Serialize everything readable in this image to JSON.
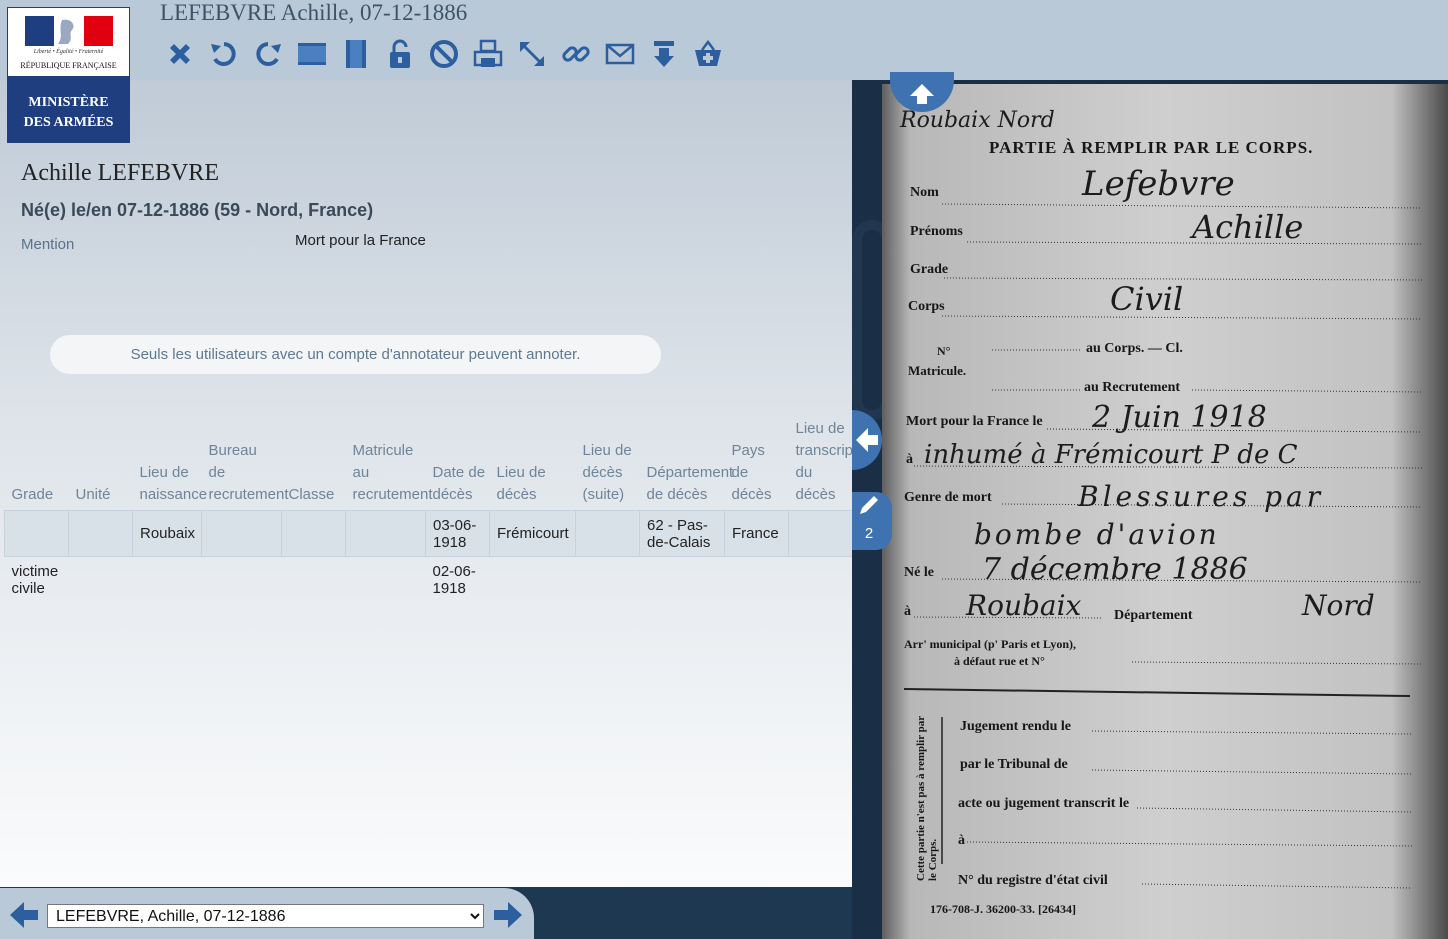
{
  "header": {
    "title": "LEFEBVRE Achille, 07-12-1886",
    "logo": {
      "motto": "Liberté • Égalité • Fraternité",
      "republic": "RÉPUBLIQUE FRANÇAISE",
      "ministry_line1": "MINISTÈRE",
      "ministry_line2": "DES ARMÉES"
    },
    "toolbar": [
      "close-icon",
      "rotate-left-icon",
      "rotate-right-icon",
      "fit-width-icon",
      "fit-height-icon",
      "unlock-icon",
      "block-icon",
      "print-icon",
      "fullscreen-icon",
      "link-icon",
      "mail-icon",
      "download-icon",
      "basket-icon"
    ],
    "accent": "#2d5f9e"
  },
  "record": {
    "name": "Achille LEFEBVRE",
    "birth": "Né(e) le/en 07-12-1886 (59 - Nord, France)",
    "mention_label": "Mention",
    "mention_value": "Mort pour la France",
    "annotation_notice": "Seuls les utilisateurs avec un compte d'annotateur peuvent annoter."
  },
  "table": {
    "headers": [
      "Grade",
      "Unité",
      "Lieu de naissance",
      "Bureau de recrutement",
      "Classe",
      "Matricule au recrutement",
      "Date de décès",
      "Lieu de décès",
      "Lieu de décès (suite)",
      "Département de décès",
      "Pays de décès",
      "Lieu de transcription du décès"
    ],
    "rows": [
      [
        "",
        "",
        "Roubaix",
        "",
        "",
        "",
        "03-06-1918",
        "Frémicourt",
        "",
        "62 - Pas-de-Calais",
        "France",
        ""
      ],
      [
        "victime civile",
        "",
        "",
        "",
        "",
        "",
        "02-06-1918",
        "",
        "",
        "",
        "",
        ""
      ]
    ]
  },
  "nav": {
    "selected_record": "LEFEBVRE, Achille, 07-12-1886"
  },
  "viewer": {
    "annotation_count": "2",
    "document": {
      "heading": "PARTIE À REMPLIR PAR LE CORPS.",
      "corner_note": "Roubaix Nord",
      "labels": [
        "Nom",
        "Prénoms",
        "Grade",
        "Corps",
        "N°",
        "Matricule.",
        "au Corps. — Cl.",
        "au Recrutement",
        "Mort pour la France le",
        "à",
        "Genre de mort",
        "Né le",
        "à",
        "Département",
        "Arr' municipal (p' Paris et Lyon),",
        "à défaut rue et N°",
        "Jugement rendu le",
        "par le Tribunal de",
        "acte ou jugement transcrit le",
        "à",
        "N° du registre d'état civil"
      ],
      "side_note": "Cette partie n'est pas à remplir par le Corps.",
      "footer": "176-708-J. 36200-33.   [26434]",
      "handwritten": {
        "nom": "Lefebvre",
        "prenoms": "Achille",
        "corps": "Civil",
        "mort_date": "2 Juin 1918",
        "mort_lieu": "inhumé à Frémicourt P de C",
        "genre": "Blessures par",
        "genre2": "bombe d'avion",
        "ne_le": "7 décembre 1886",
        "ne_a": "Roubaix",
        "departement": "Nord"
      }
    }
  }
}
